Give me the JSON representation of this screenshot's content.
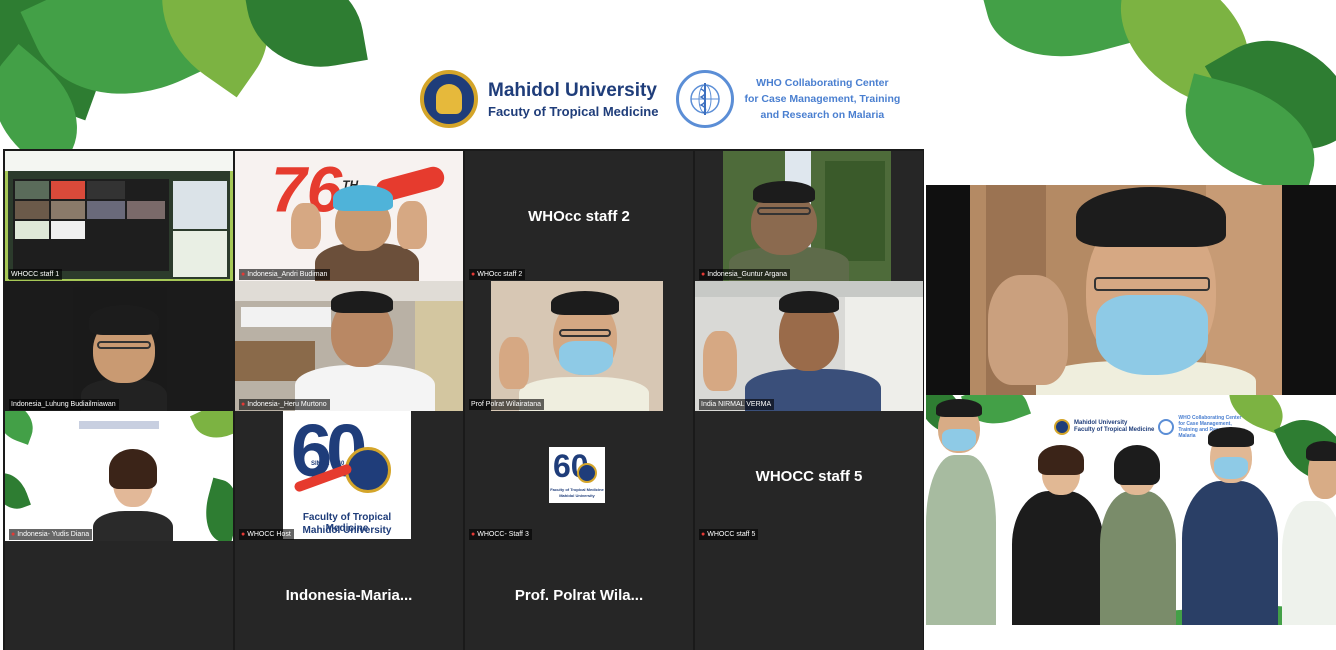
{
  "header": {
    "university_name": "Mahidol University",
    "faculty_name": "Facuty of Tropical Medicine",
    "who_lines": [
      "WHO Collaborating Center",
      "for Case Management, Training",
      "and Research on Malaria"
    ],
    "seal_icon": "mahidol-seal-icon",
    "who_icon": "who-emblem-icon"
  },
  "gallery": {
    "tiles": [
      {
        "name": "WHOCC staff 1",
        "muted": false,
        "active": true
      },
      {
        "name": "Indonesia_Andri Budiman",
        "muted": true
      },
      {
        "name": "WHOcc staff 2",
        "muted": true,
        "center_text": "WHOcc staff 2"
      },
      {
        "name": "Indonesia_Guntur Argana",
        "muted": true
      },
      {
        "name": "Indonesia_Luhung Budiailmiawan",
        "muted": false
      },
      {
        "name": "Indonesia-_Heru Murtono",
        "muted": true
      },
      {
        "name": "Prof Polrat Wilairatana",
        "muted": false
      },
      {
        "name": "India NIRMAL VERMA",
        "muted": false
      },
      {
        "name": "Indonesia- Yudis Diana",
        "muted": true
      },
      {
        "name": "WHOCC Host",
        "muted": true
      },
      {
        "name": "WHOCC- Staff 3",
        "muted": true
      },
      {
        "name": "WHOCC staff 5",
        "muted": true,
        "center_text": "WHOCC staff 5"
      },
      {
        "name": "",
        "center_text": ""
      },
      {
        "name": "",
        "center_text": "Indonesia-Maria..."
      },
      {
        "name": "",
        "center_text": "Prof. Polrat Wila..."
      },
      {
        "name": "",
        "center_text": ""
      }
    ],
    "anniversary_tile": {
      "number": "60",
      "since": "SINCE 1960",
      "faculty": "Faculty of Tropical Medicine",
      "university": "Mahidol University"
    },
    "anniversary_small": {
      "line1": "Faculty of Tropical Medicine",
      "line2": "Mahidol University"
    },
    "seventy_sixth": {
      "number": "76",
      "suffix": "TH"
    }
  },
  "group_panel": {
    "mini_uni": "Mahidol University",
    "mini_faculty": "Faculty of Tropical Medicine",
    "mini_who": "WHO Collaborating Center for Case Management, Training and Research on Malaria"
  },
  "colors": {
    "gallery_bg": "#1a1a1a",
    "tile_bg": "#262626",
    "active_border": "#a7c957",
    "brand_blue": "#1f3d7a",
    "who_blue": "#4a7fd0"
  }
}
